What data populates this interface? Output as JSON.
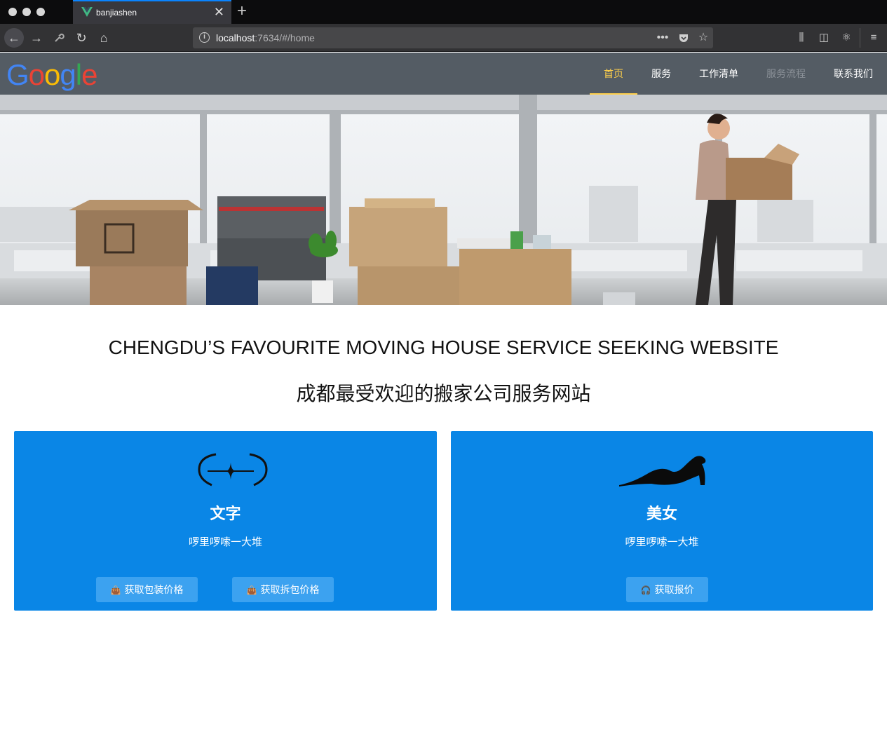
{
  "browser": {
    "tab_title": "banjiashen",
    "url_host": "localhost",
    "url_rest": ":7634/#/home"
  },
  "header": {
    "logo": "Google",
    "nav": [
      {
        "label": "首页",
        "state": "active"
      },
      {
        "label": "服务",
        "state": "normal"
      },
      {
        "label": "工作清单",
        "state": "normal"
      },
      {
        "label": "服务流程",
        "state": "disabled"
      },
      {
        "label": "联系我们",
        "state": "normal"
      }
    ]
  },
  "headline": {
    "en": "CHENGDU’S FAVOURITE MOVING HOUSE SERVICE SEEKING WEBSITE",
    "zh": "成都最受欢迎的搬家公司服务网站"
  },
  "cards": [
    {
      "title": "文字",
      "desc": "啰里啰嗦一大堆",
      "buttons": [
        "获取包装价格",
        "获取拆包价格"
      ]
    },
    {
      "title": "美女",
      "desc": "啰里啰嗦一大堆",
      "buttons": [
        "获取报价"
      ]
    }
  ],
  "colors": {
    "header_bg": "#545c64",
    "nav_active": "#ffd04b",
    "card_bg": "#0a86e6",
    "button_bg": "#3ca2f0"
  }
}
